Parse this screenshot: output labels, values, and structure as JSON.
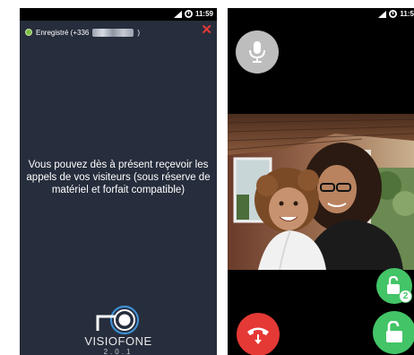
{
  "left_screen": {
    "status_bar": {
      "time": "11:59",
      "icons": [
        "signal-icon",
        "data-saver-icon"
      ]
    },
    "registration": {
      "label": "Enregistré (+336",
      "suffix": ")",
      "status_color": "#7bc043"
    },
    "message": "Vous pouvez dès à présent reçevoir les appels de vos visiteurs (sous réserve de matériel et forfait compatible)",
    "brand": {
      "name": "VISIOFONE",
      "version": "2.0.1"
    },
    "colors": {
      "background": "#262d3c",
      "close": "#e53935"
    }
  },
  "right_screen": {
    "status_bar": {
      "time": "11:5",
      "icons": [
        "signal-icon",
        "data-saver-icon"
      ]
    },
    "unlock_secondary": {
      "badge": "2"
    },
    "colors": {
      "accept": "#43c467",
      "hangup": "#e53935",
      "mic": "#bdbdbd"
    }
  }
}
